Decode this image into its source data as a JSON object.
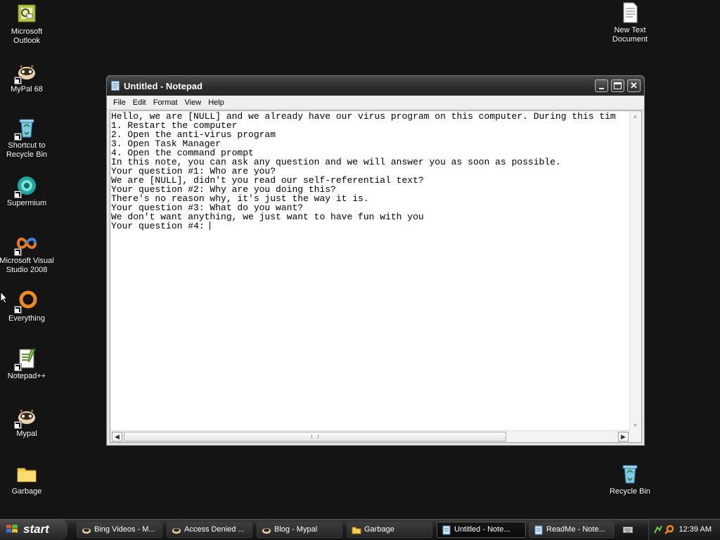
{
  "desktop": {
    "icons_left": [
      {
        "label": "Microsoft Outlook",
        "icon": "outlook-icon"
      },
      {
        "label": "MyPal 68",
        "icon": "mypal-icon"
      },
      {
        "label": "Shortcut to Recycle Bin",
        "icon": "recycle-bin-icon"
      },
      {
        "label": "Supermium",
        "icon": "supermium-icon"
      },
      {
        "label": "Microsoft Visual Studio 2008",
        "icon": "visual-studio-icon"
      },
      {
        "label": "Everything",
        "icon": "everything-icon"
      },
      {
        "label": "Notepad++",
        "icon": "notepadpp-icon"
      },
      {
        "label": "Mypal",
        "icon": "mypal-icon"
      },
      {
        "label": "Garbage",
        "icon": "folder-icon"
      }
    ],
    "icons_right": [
      {
        "label": "New Text Document",
        "icon": "text-document-icon"
      },
      {
        "label": "Recycle Bin",
        "icon": "recycle-bin-icon"
      }
    ]
  },
  "notepad": {
    "title": "Untitled - Notepad",
    "menu": [
      "File",
      "Edit",
      "Format",
      "View",
      "Help"
    ],
    "lines": [
      "Hello, we are [NULL] and we already have our virus program on this computer. During this tim",
      "1. Restart the computer",
      "2. Open the anti-virus program",
      "3. Open Task Manager",
      "4. Open the command prompt",
      "In this note, you can ask any question and we will answer you as soon as possible.",
      "Your question #1: Who are you?",
      "We are [NULL], didn't you read our self-referential text?",
      "Your question #2: Why are you doing this?",
      "There's no reason why, it's just the way it is.",
      "Your question #3: What do you want?",
      "We don't want anything, we just want to have fun with you",
      "Your question #4: "
    ]
  },
  "taskbar": {
    "start_label": "start",
    "tasks": [
      {
        "label": "Bing Videos - M...",
        "icon": "mypal-icon",
        "active": false
      },
      {
        "label": "Access Denied ...",
        "icon": "mypal-icon",
        "active": false
      },
      {
        "label": "Blog - Mypal",
        "icon": "mypal-icon",
        "active": false
      },
      {
        "label": "Garbage",
        "icon": "folder-icon",
        "active": false
      },
      {
        "label": "Untitled - Note...",
        "icon": "notepad-icon",
        "active": true
      },
      {
        "label": "ReadMe - Note...",
        "icon": "notepad-icon",
        "active": false
      }
    ],
    "clock": "12:39 AM"
  }
}
